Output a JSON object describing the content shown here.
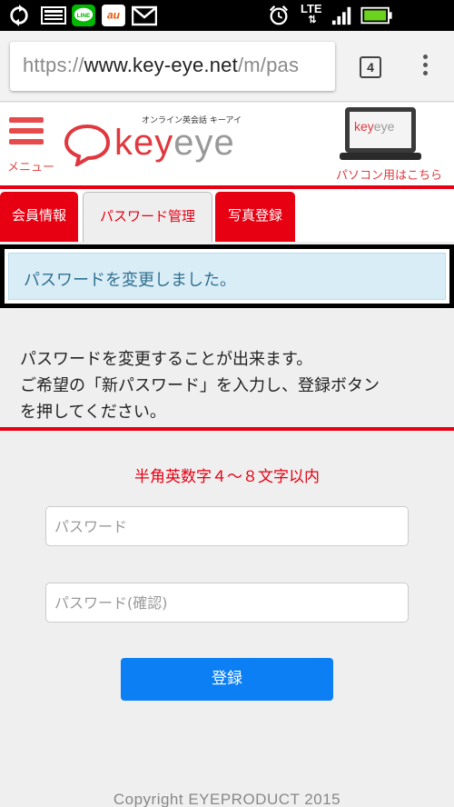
{
  "status_bar": {
    "icons": [
      "sync-icon",
      "screen-icon",
      "line-app-icon",
      "au-app-icon",
      "gmail-icon",
      "alarm-icon",
      "lte-icon",
      "signal-icon",
      "battery-icon"
    ],
    "network_label": "LTE",
    "line_label": "LINE",
    "au_label": "au"
  },
  "browser": {
    "url_scheme": "https://",
    "url_host": "www.key-eye.net",
    "url_path": "/m/pas",
    "tab_count": "4"
  },
  "header": {
    "menu_label": "メニュー",
    "logo_tagline": "オンライン英会話 キーアイ",
    "logo_key": "key",
    "logo_eye": "eye",
    "pc_link_label": "パソコン用はこちら",
    "pc_screen_key": "key",
    "pc_screen_eye": "eye"
  },
  "tabs": [
    {
      "label": "会員情報",
      "active": false
    },
    {
      "label": "パスワード管理",
      "active": true
    },
    {
      "label": "写真登録",
      "active": false
    }
  ],
  "alert": {
    "message": "パスワードを変更しました。"
  },
  "description": {
    "line1": "パスワードを変更することが出来ます。",
    "line2": "ご希望の「新パスワード」を入力し、登録ボタン",
    "line3": "を押してください。"
  },
  "rule_text": "半角英数字４～８文字以内",
  "form": {
    "password_placeholder": "パスワード",
    "password_confirm_placeholder": "パスワード(確認)",
    "submit_label": "登録"
  },
  "footer": {
    "copyright": "Copyright EYEPRODUCT 2015"
  },
  "colors": {
    "accent_red": "#e60012",
    "button_blue": "#0d7ff5",
    "alert_bg": "#d9edf7",
    "alert_text": "#31708f"
  }
}
